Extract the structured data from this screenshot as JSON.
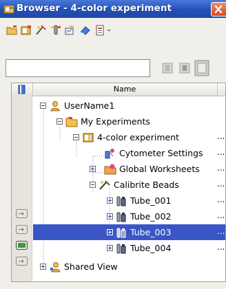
{
  "window": {
    "title": "Browser - 4-color experiment"
  },
  "search": {
    "value": ""
  },
  "tree": {
    "header": {
      "name_label": "Name"
    },
    "rows": [
      {
        "label": "UserName1",
        "more": ""
      },
      {
        "label": "My Experiments",
        "more": ""
      },
      {
        "label": "4-color experiment",
        "more": "..."
      },
      {
        "label": "Cytometer Settings",
        "more": "..."
      },
      {
        "label": "Global Worksheets",
        "more": "..."
      },
      {
        "label": "Calibrite Beads",
        "more": "..."
      },
      {
        "label": "Tube_001",
        "more": "..."
      },
      {
        "label": "Tube_002",
        "more": "..."
      },
      {
        "label": "Tube_003",
        "more": "...",
        "selected": true
      },
      {
        "label": "Tube_004",
        "more": "..."
      },
      {
        "label": "Shared View",
        "more": ""
      }
    ]
  },
  "colors": {
    "titlebar": "#2350b8",
    "selection": "#3a56c6",
    "active_tube_indicator": "#3a9a3a"
  }
}
